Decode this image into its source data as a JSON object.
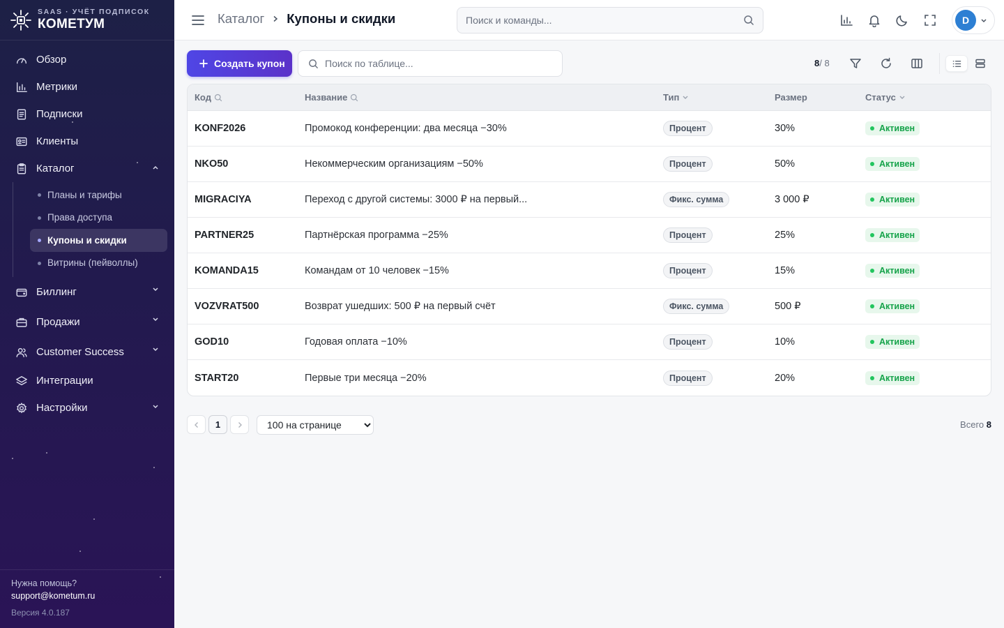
{
  "brand": {
    "subtitle": "SAAS · УЧЁТ ПОДПИСОК",
    "name": "КОМЕТУМ"
  },
  "sidebar": {
    "items": [
      {
        "label": "Обзор",
        "icon": "gauge-icon"
      },
      {
        "label": "Метрики",
        "icon": "bar-chart-icon"
      },
      {
        "label": "Подписки",
        "icon": "document-icon"
      },
      {
        "label": "Клиенты",
        "icon": "id-card-icon"
      },
      {
        "label": "Каталог",
        "icon": "clipboard-icon",
        "expanded": true
      }
    ],
    "catalog_sub": [
      {
        "label": "Планы и тарифы"
      },
      {
        "label": "Права доступа"
      },
      {
        "label": "Купоны и скидки",
        "active": true
      },
      {
        "label": "Витрины (пейволлы)"
      }
    ],
    "items_after": [
      {
        "label": "Биллинг",
        "icon": "wallet-icon"
      },
      {
        "label": "Продажи",
        "icon": "briefcase-icon"
      },
      {
        "label": "Customer Success",
        "icon": "users-icon"
      },
      {
        "label": "Интеграции",
        "icon": "layers-icon"
      },
      {
        "label": "Настройки",
        "icon": "gear-icon"
      }
    ],
    "footer": {
      "help": "Нужна помощь?",
      "email": "support@kometum.ru",
      "version": "Версия 4.0.187"
    }
  },
  "header": {
    "breadcrumb_root": "Каталог",
    "breadcrumb_current": "Купоны и скидки",
    "search_placeholder": "Поиск и команды...",
    "avatar_letter": "D"
  },
  "toolbar": {
    "create_label": "Создать купон",
    "search_placeholder": "Поиск по таблице...",
    "count_shown": "8",
    "count_total": "/ 8"
  },
  "table": {
    "columns": {
      "code": "Код",
      "name": "Название",
      "type": "Тип",
      "size": "Размер",
      "status": "Статус"
    },
    "rows": [
      {
        "code": "KONF2026",
        "name": "Промокод конференции: два месяца −30%",
        "type": "Процент",
        "size": "30%",
        "status": "Активен"
      },
      {
        "code": "NKO50",
        "name": "Некоммерческим организациям −50%",
        "type": "Процент",
        "size": "50%",
        "status": "Активен"
      },
      {
        "code": "MIGRACIYA",
        "name": "Переход с другой системы: 3000 ₽ на первый...",
        "type": "Фикс. сумма",
        "size": "3 000 ₽",
        "status": "Активен"
      },
      {
        "code": "PARTNER25",
        "name": "Партнёрская программа −25%",
        "type": "Процент",
        "size": "25%",
        "status": "Активен"
      },
      {
        "code": "KOMANDA15",
        "name": "Командам от 10 человек −15%",
        "type": "Процент",
        "size": "15%",
        "status": "Активен"
      },
      {
        "code": "VOZVRAT500",
        "name": "Возврат ушедших: 500 ₽ на первый счёт",
        "type": "Фикс. сумма",
        "size": "500 ₽",
        "status": "Активен"
      },
      {
        "code": "GOD10",
        "name": "Годовая оплата −10%",
        "type": "Процент",
        "size": "10%",
        "status": "Активен"
      },
      {
        "code": "START20",
        "name": "Первые три месяца −20%",
        "type": "Процент",
        "size": "20%",
        "status": "Активен"
      }
    ]
  },
  "pagination": {
    "current_page": "1",
    "per_page": "100 на странице",
    "total_label": "Всего",
    "total_value": "8"
  },
  "colors": {
    "accent": "#4f46e5",
    "sidebar": "#221a4e",
    "status_active": "#16a34a"
  }
}
